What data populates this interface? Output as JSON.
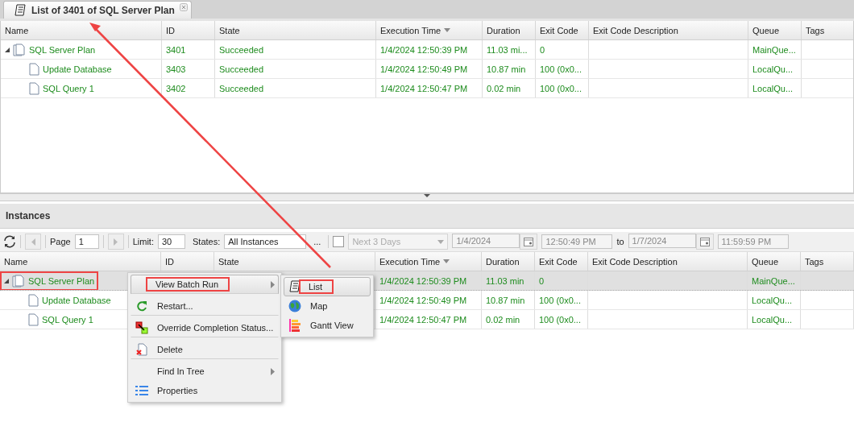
{
  "tab": {
    "title": "List of 3401 of SQL Server Plan",
    "selected": true
  },
  "top_grid": {
    "columns": [
      {
        "label": "Name",
        "sorted": false
      },
      {
        "label": "ID",
        "sorted": false
      },
      {
        "label": "State",
        "sorted": false
      },
      {
        "label": "Execution Time",
        "sorted": true
      },
      {
        "label": "Duration",
        "sorted": false
      },
      {
        "label": "Exit Code",
        "sorted": false
      },
      {
        "label": "Exit Code Description",
        "sorted": false
      },
      {
        "label": "Queue",
        "sorted": false
      },
      {
        "label": "Tags",
        "sorted": false
      }
    ],
    "rows": [
      {
        "name": "SQL Server Plan",
        "id": "3401",
        "state": "Succeeded",
        "execution_time": "1/4/2024 12:50:39 PM",
        "duration": "11.03 mi...",
        "exit_code": "0",
        "queue": "MainQue...",
        "expanded": true,
        "selected": false,
        "highlighted": false,
        "children": [
          {
            "name": "Update Database",
            "id": "3403",
            "state": "Succeeded",
            "execution_time": "1/4/2024 12:50:49 PM",
            "duration": "10.87 min",
            "exit_code": "100 (0x0...",
            "queue": "LocalQu...",
            "selected": false,
            "highlighted": false
          },
          {
            "name": "SQL Query 1",
            "id": "3402",
            "state": "Succeeded",
            "execution_time": "1/4/2024 12:50:47 PM",
            "duration": "0.02 min",
            "exit_code": "100 (0x0...",
            "queue": "LocalQu...",
            "selected": false,
            "highlighted": false
          }
        ]
      }
    ]
  },
  "instances": {
    "title": "Instances",
    "toolbar": {
      "page_label": "Page",
      "page": "1",
      "limit_label": "Limit:",
      "limit": "30",
      "states_label": "States:",
      "states": "All Instances",
      "more": "...",
      "next_days_checked": false,
      "next_days": "Next 3 Days",
      "from_date": "1/4/2024",
      "from_time": "12:50:49 PM",
      "to_label": "to",
      "to_date": "1/7/2024",
      "to_time": "11:59:59 PM"
    },
    "grid": {
      "columns": [
        {
          "label": "Name",
          "sorted": false
        },
        {
          "label": "ID",
          "sorted": false
        },
        {
          "label": "State",
          "sorted": false
        },
        {
          "label": "Execution Time",
          "sorted": true
        },
        {
          "label": "Duration",
          "sorted": false
        },
        {
          "label": "Exit Code",
          "sorted": false
        },
        {
          "label": "Exit Code Description",
          "sorted": false
        },
        {
          "label": "Queue",
          "sorted": false
        },
        {
          "label": "Tags",
          "sorted": false
        }
      ],
      "rows": [
        {
          "name": "SQL Server Plan",
          "execution_time": "1/4/2024 12:50:39 PM",
          "duration": "11.03 min",
          "exit_code": "0",
          "queue": "MainQue...",
          "expanded": true,
          "selected": true,
          "highlighted": true,
          "children": [
            {
              "name": "Update Database",
              "execution_time": "1/4/2024 12:50:49 PM",
              "duration": "10.87 min",
              "exit_code": "100 (0x0...",
              "queue": "LocalQu...",
              "selected": false,
              "highlighted": false
            },
            {
              "name": "SQL Query 1",
              "execution_time": "1/4/2024 12:50:47 PM",
              "duration": "0.02 min",
              "exit_code": "100 (0x0...",
              "queue": "LocalQu...",
              "selected": false,
              "highlighted": false
            }
          ]
        }
      ]
    }
  },
  "context_menu": {
    "items": [
      {
        "label": "View Batch Run",
        "kind": "none",
        "submenu": true,
        "selected": true,
        "highlighted": true,
        "divider_after": true
      },
      {
        "label": "Restart...",
        "kind": "restart",
        "submenu": false,
        "selected": false,
        "highlighted": false,
        "divider_after": true
      },
      {
        "label": "Override Completion Status...",
        "kind": "override",
        "submenu": false,
        "selected": false,
        "highlighted": false,
        "divider_after": true
      },
      {
        "label": "Delete",
        "kind": "delete",
        "submenu": false,
        "selected": false,
        "highlighted": false,
        "divider_after": true
      },
      {
        "label": "Find In Tree",
        "kind": "none",
        "submenu": true,
        "selected": false,
        "highlighted": false,
        "divider_after": false
      },
      {
        "label": "Properties",
        "kind": "properties",
        "submenu": false,
        "selected": false,
        "highlighted": false,
        "divider_after": false
      }
    ],
    "submenu": [
      {
        "label": "List",
        "kind": "list",
        "selected": true,
        "highlighted": true
      },
      {
        "label": "Map",
        "kind": "globe",
        "selected": false,
        "highlighted": false
      },
      {
        "label": "Gantt View",
        "kind": "gantt",
        "selected": false,
        "highlighted": false
      }
    ]
  }
}
